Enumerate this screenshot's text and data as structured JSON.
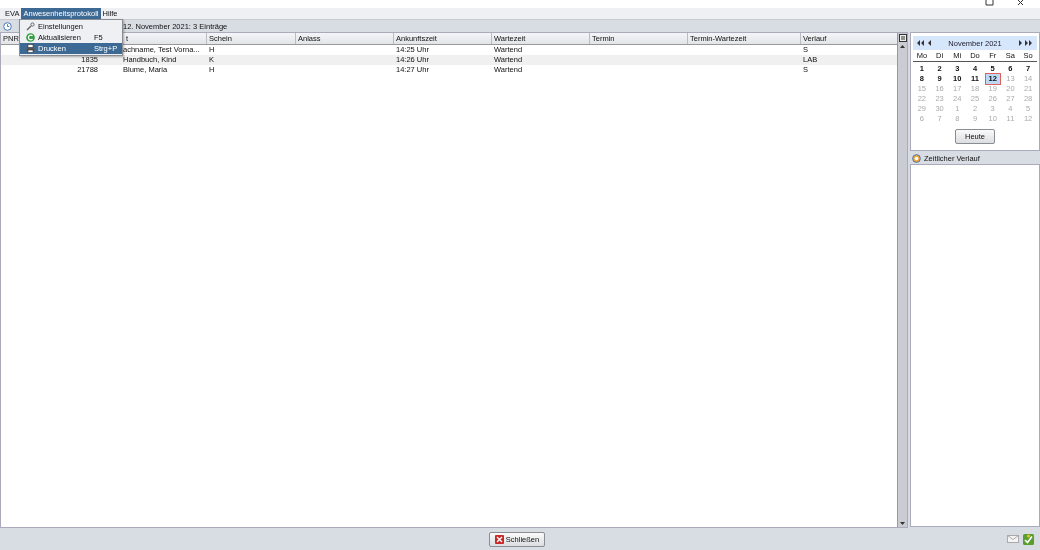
{
  "menu_bar": [
    {
      "label": "EVA",
      "selected": false
    },
    {
      "label": "Anwesenheitsprotokoll",
      "selected": true
    },
    {
      "label": "Hilfe",
      "selected": false
    }
  ],
  "open_menu": {
    "items": [
      {
        "kind": "settings",
        "label": "Einstellungen",
        "selected": false
      },
      {
        "kind": "refresh",
        "label": "Aktualisieren",
        "shortcut": "F5",
        "selected": false
      },
      {
        "kind": "print",
        "label": "Drucken",
        "shortcut": "Strg+P",
        "selected": true
      }
    ]
  },
  "toolbar": {
    "summary": "12. November 2021: 3 Einträge"
  },
  "table": {
    "columns": [
      "PNR",
      "",
      "t",
      "Schein",
      "Anlass",
      "Ankunftszeit",
      "Wartezeit",
      "Termin",
      "Termin-Wartezeit",
      "Verlauf"
    ],
    "rows": [
      {
        "cells": [
          "",
          "",
          "achname, Test Vorna...",
          "H",
          "",
          "14:25 Uhr",
          "Wartend",
          "",
          "",
          "S"
        ]
      },
      {
        "cells": [
          "",
          "1835",
          "Handbuch, Kind",
          "K",
          "",
          "14:26 Uhr",
          "Wartend",
          "",
          "",
          "LAB"
        ]
      },
      {
        "cells": [
          "",
          "21788",
          "Blume, Maria",
          "H",
          "",
          "14:27 Uhr",
          "Wartend",
          "",
          "",
          "S"
        ]
      }
    ]
  },
  "calendar": {
    "month": "November 2021",
    "weekdays": [
      "Mo",
      "Di",
      "Mi",
      "Do",
      "Fr",
      "Sa",
      "So"
    ],
    "days": [
      {
        "label": "1",
        "muted": false,
        "selected": false
      },
      {
        "label": "2",
        "muted": false,
        "selected": false
      },
      {
        "label": "3",
        "muted": false,
        "selected": false
      },
      {
        "label": "4",
        "muted": false,
        "selected": false
      },
      {
        "label": "5",
        "muted": false,
        "selected": false
      },
      {
        "label": "6",
        "muted": false,
        "selected": false
      },
      {
        "label": "7",
        "muted": false,
        "selected": false
      },
      {
        "label": "8",
        "muted": false,
        "selected": false
      },
      {
        "label": "9",
        "muted": false,
        "selected": false
      },
      {
        "label": "10",
        "muted": false,
        "selected": false
      },
      {
        "label": "11",
        "muted": false,
        "selected": false
      },
      {
        "label": "12",
        "muted": false,
        "selected": true
      },
      {
        "label": "13",
        "muted": true,
        "selected": false
      },
      {
        "label": "14",
        "muted": true,
        "selected": false
      },
      {
        "label": "15",
        "muted": true,
        "selected": false
      },
      {
        "label": "16",
        "muted": true,
        "selected": false
      },
      {
        "label": "17",
        "muted": true,
        "selected": false
      },
      {
        "label": "18",
        "muted": true,
        "selected": false
      },
      {
        "label": "19",
        "muted": true,
        "selected": false
      },
      {
        "label": "20",
        "muted": true,
        "selected": false
      },
      {
        "label": "21",
        "muted": true,
        "selected": false
      },
      {
        "label": "22",
        "muted": true,
        "selected": false
      },
      {
        "label": "23",
        "muted": true,
        "selected": false
      },
      {
        "label": "24",
        "muted": true,
        "selected": false
      },
      {
        "label": "25",
        "muted": true,
        "selected": false
      },
      {
        "label": "26",
        "muted": true,
        "selected": false
      },
      {
        "label": "27",
        "muted": true,
        "selected": false
      },
      {
        "label": "28",
        "muted": true,
        "selected": false
      },
      {
        "label": "29",
        "muted": true,
        "selected": false
      },
      {
        "label": "30",
        "muted": true,
        "selected": false
      },
      {
        "label": "1",
        "muted": true,
        "selected": false
      },
      {
        "label": "2",
        "muted": true,
        "selected": false
      },
      {
        "label": "3",
        "muted": true,
        "selected": false
      },
      {
        "label": "4",
        "muted": true,
        "selected": false
      },
      {
        "label": "5",
        "muted": true,
        "selected": false
      },
      {
        "label": "6",
        "muted": true,
        "selected": false
      },
      {
        "label": "7",
        "muted": true,
        "selected": false
      },
      {
        "label": "8",
        "muted": true,
        "selected": false
      },
      {
        "label": "9",
        "muted": true,
        "selected": false
      },
      {
        "label": "10",
        "muted": true,
        "selected": false
      },
      {
        "label": "11",
        "muted": true,
        "selected": false
      },
      {
        "label": "12",
        "muted": true,
        "selected": false
      }
    ],
    "today_button": "Heute"
  },
  "history_panel": {
    "title": "Zeitlicher Verlauf"
  },
  "footer": {
    "close_button": "Schließen"
  }
}
